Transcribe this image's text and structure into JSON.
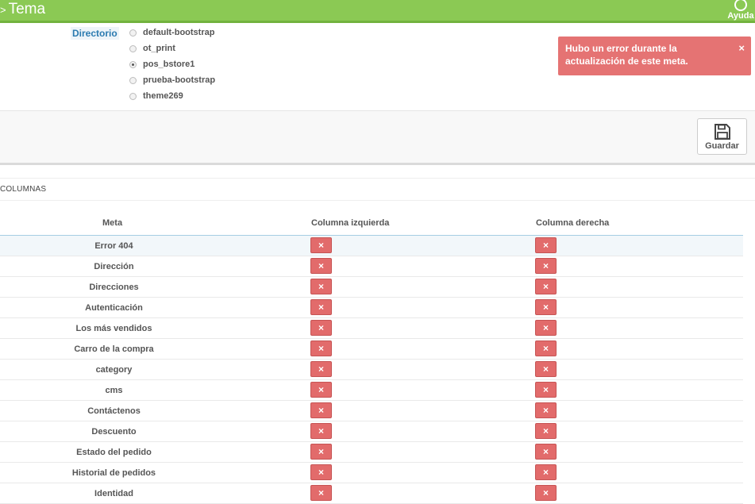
{
  "header": {
    "title": "Tema",
    "arrow": ">",
    "help_label": "Ayuda"
  },
  "directory": {
    "label": "Directorio",
    "options": [
      "default-bootstrap",
      "ot_print",
      "pos_bstore1",
      "prueba-bootstrap",
      "theme269"
    ],
    "selected": "pos_bstore1"
  },
  "alert": {
    "message": "Hubo un error durante la actualización de este meta.",
    "close": "×"
  },
  "save_button": {
    "label": "Guardar"
  },
  "panel": {
    "title": "COLUMNAS"
  },
  "table": {
    "headers": [
      "Meta",
      "Columna izquierda",
      "Columna derecha"
    ],
    "rows": [
      "Error 404",
      "Dirección",
      "Direcciones",
      "Autenticación",
      "Los más vendidos",
      "Carro de la compra",
      "category",
      "cms",
      "Contáctenos",
      "Descuento",
      "Estado del pedido",
      "Historial de pedidos",
      "Identidad"
    ],
    "cell_icon": "×"
  },
  "colors": {
    "topbar": "#8bc954",
    "alert": "#e57373",
    "disabled_button": "#e26b6b",
    "link": "#2a7ab0"
  }
}
